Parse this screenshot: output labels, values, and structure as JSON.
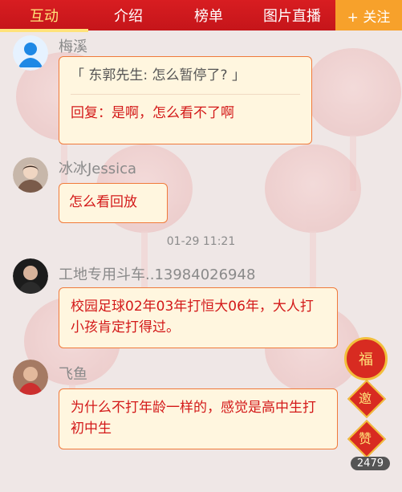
{
  "tabs": [
    "互动",
    "介绍",
    "榜单",
    "图片直播"
  ],
  "follow_label": "+ 关注",
  "messages": [
    {
      "name": "梅溪",
      "quote": "「 东郭先生: 怎么暂停了? 」",
      "text": "回复：是啊，怎么看不了啊"
    },
    {
      "name": "冰冰Jessica",
      "text": "怎么看回放"
    },
    {
      "name": "工地专用斗车..13984026948",
      "text": "校园足球02年03年打恒大06年，大人打小孩肯定打得过。"
    },
    {
      "name": "飞鱼",
      "text": "为什么不打年龄一样的，感觉是高中生打初中生"
    }
  ],
  "timestamp": "01-29 11:21",
  "decor": {
    "fu": "福",
    "yao": "邀",
    "zan": "赞"
  },
  "viewer_count": "2479",
  "colors": {
    "tabbar": "#d81d21",
    "follow": "#f7a12b",
    "bubble_border": "#f07a3a",
    "bubble_bg": "#fff6df",
    "text_red": "#d31919"
  }
}
